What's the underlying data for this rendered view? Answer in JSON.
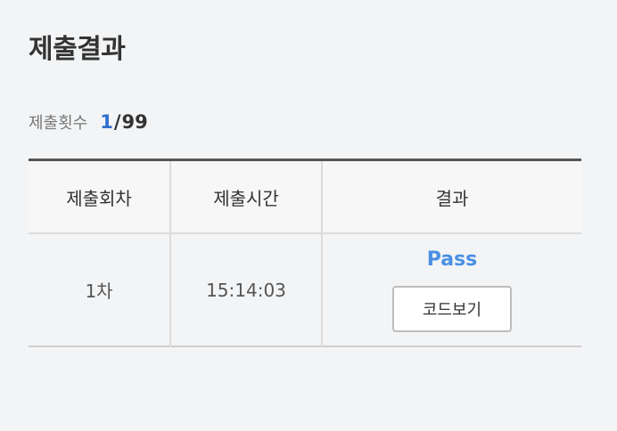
{
  "panel": {
    "title": "제출결과"
  },
  "submission_count": {
    "label": "제출횟수",
    "current": "1",
    "separator": "/",
    "max": "99"
  },
  "results_table": {
    "headers": [
      "제출회차",
      "제출시간",
      "결과"
    ],
    "rows": [
      {
        "round": "1차",
        "time": "15:14:03",
        "result": "Pass",
        "code_button_label": "코드보기"
      }
    ]
  },
  "colors": {
    "count_accent": "#2f6fce",
    "pass_status": "#4a90e2"
  }
}
